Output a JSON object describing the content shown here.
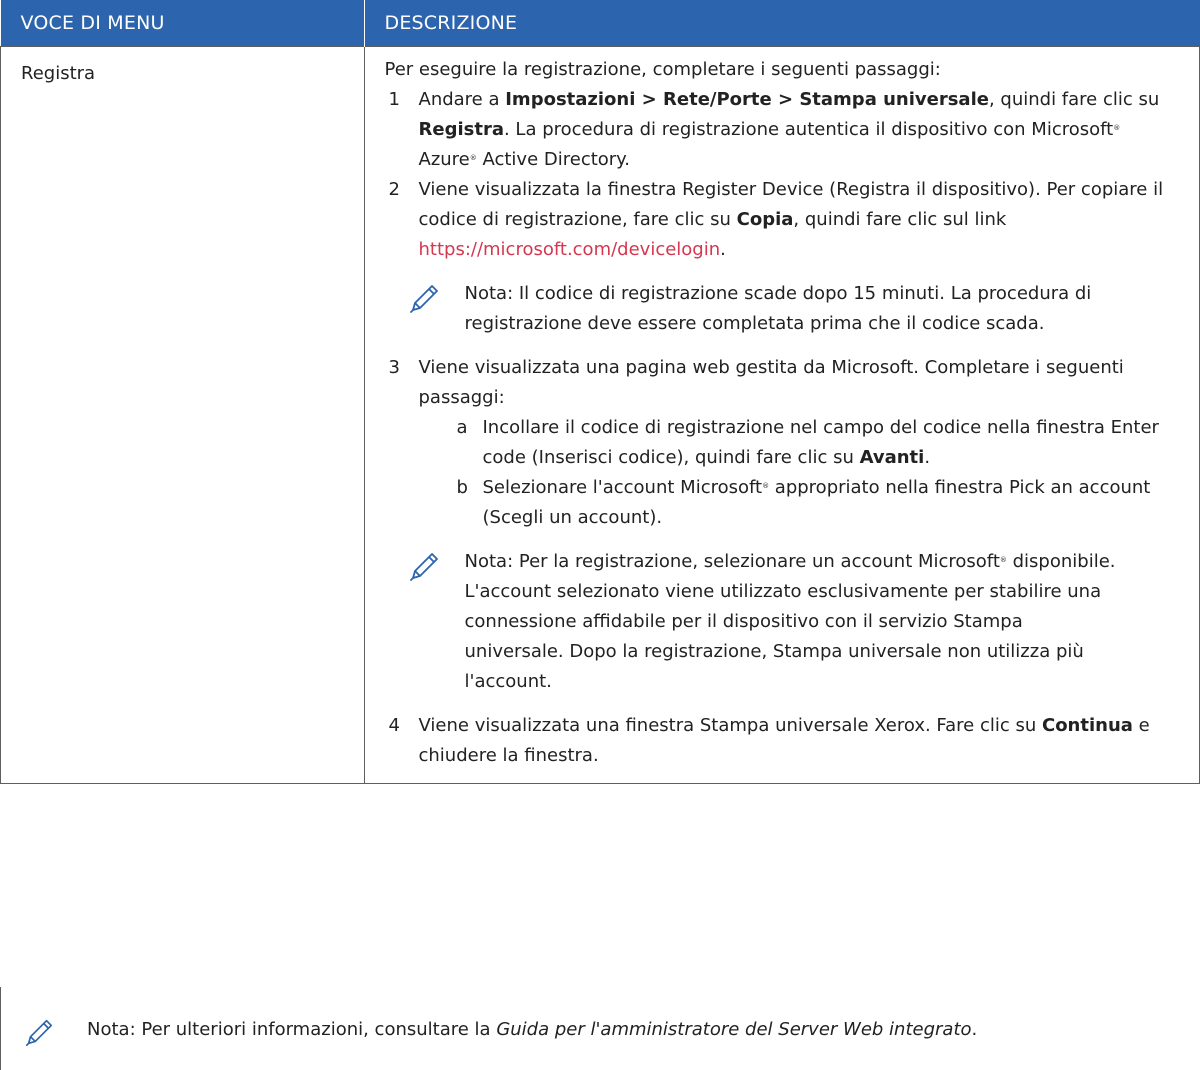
{
  "header": {
    "col1": "VOCE DI MENU",
    "col2": "DESCRIZIONE"
  },
  "row": {
    "item": "Registra",
    "intro": "Per eseguire la registrazione, completare i seguenti passaggi:",
    "steps": [
      {
        "num": "1",
        "parts": [
          "Andare a ",
          "Impostazioni > Rete/Porte > Stampa universale",
          ", quindi fare clic su ",
          "Registra",
          ". La procedura di registrazione autentica il dispositivo con Microsoft",
          "®",
          " Azure",
          "®",
          " Active Directory."
        ]
      },
      {
        "num": "2",
        "parts": [
          "Viene visualizzata la finestra Register Device (Registra il dispositivo). Per copiare il codice di registrazione, fare clic su ",
          "Copia",
          ", quindi fare clic sul link ",
          "https://microsoft.com/devicelogin",
          "."
        ]
      },
      {
        "num": "3",
        "text": "Viene visualizzata una pagina web gestita da Microsoft. Completare i seguenti passaggi:"
      },
      {
        "num": "4",
        "parts": [
          "Viene visualizzata una finestra Stampa universale Xerox. Fare clic su ",
          "Continua",
          " e chiudere la finestra."
        ]
      }
    ],
    "note1": "Nota: Il codice di registrazione scade dopo 15 minuti. La procedura di registrazione deve essere completata prima che il codice scada.",
    "substeps": [
      {
        "letter": "a",
        "parts": [
          "Incollare il codice di registrazione nel campo del codice nella finestra Enter code (Inserisci codice), quindi fare clic su ",
          "Avanti",
          "."
        ]
      },
      {
        "letter": "b",
        "parts": [
          "Selezionare l'account Microsoft",
          "®",
          " appropriato nella finestra Pick an account (Scegli un account)."
        ]
      }
    ],
    "note2": {
      "before": "Nota: Per la registrazione, selezionare un account Microsoft",
      "reg": "®",
      "after": " disponibile. L'account selezionato viene utilizzato esclusivamente per stabilire una connessione affidabile per il dispositivo con il servizio Stampa universale. Dopo la registrazione, Stampa universale non utilizza più l'account."
    }
  },
  "footer_note": {
    "before": "Nota: Per ulteriori informazioni, consultare la ",
    "italic": "Guida per l'amministratore del Server Web integrato",
    "after": "."
  },
  "colors": {
    "header_bg": "#2c64ae",
    "link": "#d4374f",
    "note_icon": "#2c64ae"
  },
  "icons": [
    "pencil-icon"
  ]
}
